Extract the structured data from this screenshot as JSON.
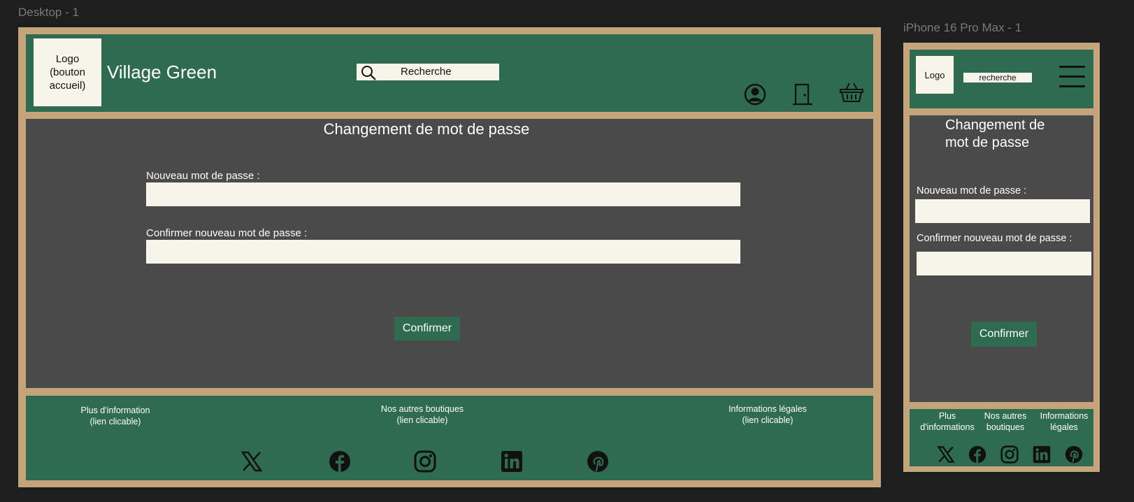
{
  "canvas": {
    "desktop_frame_label": "Desktop - 1",
    "mobile_frame_label": "iPhone 16 Pro Max - 1"
  },
  "desktop": {
    "logo_text": "Logo\n(bouton\naccueil)",
    "site_name": "Village Green",
    "search_placeholder": "Recherche",
    "page_title": "Changement de mot de passe",
    "new_password_label": "Nouveau mot de passe :",
    "confirm_password_label": "Confirmer nouveau mot de passe :",
    "confirm_button": "Confirmer",
    "header_icons": [
      "user-account-icon",
      "door-logout-icon",
      "basket-icon"
    ],
    "footer": {
      "links": [
        "Plus d'information\n(lien clicable)",
        "Nos autres boutiques\n(lien clicable)",
        "Informations légales\n(lien clicable)"
      ],
      "social_icons": [
        "x-icon",
        "facebook-icon",
        "instagram-icon",
        "linkedin-icon",
        "pinterest-icon"
      ]
    }
  },
  "mobile": {
    "logo_text": "Logo",
    "search_placeholder": "recherche",
    "page_title": "Changement de\nmot de passe",
    "new_password_label": "Nouveau mot de passe :",
    "confirm_password_label": "Confirmer nouveau mot de passe :",
    "confirm_button": "Confirmer",
    "footer": {
      "links": [
        "Plus\nd'informations",
        "Nos autres\nboutiques",
        "Informations\nlégales"
      ],
      "social_icons": [
        "x-icon",
        "facebook-icon",
        "instagram-icon",
        "linkedin-icon",
        "pinterest-icon"
      ]
    }
  },
  "colors": {
    "background": "#1e1e1e",
    "frame": "#c4a57b",
    "header_footer_green": "#2f6b51",
    "content_gray": "#4b4a4a",
    "input_cream": "#f7f4ea"
  }
}
